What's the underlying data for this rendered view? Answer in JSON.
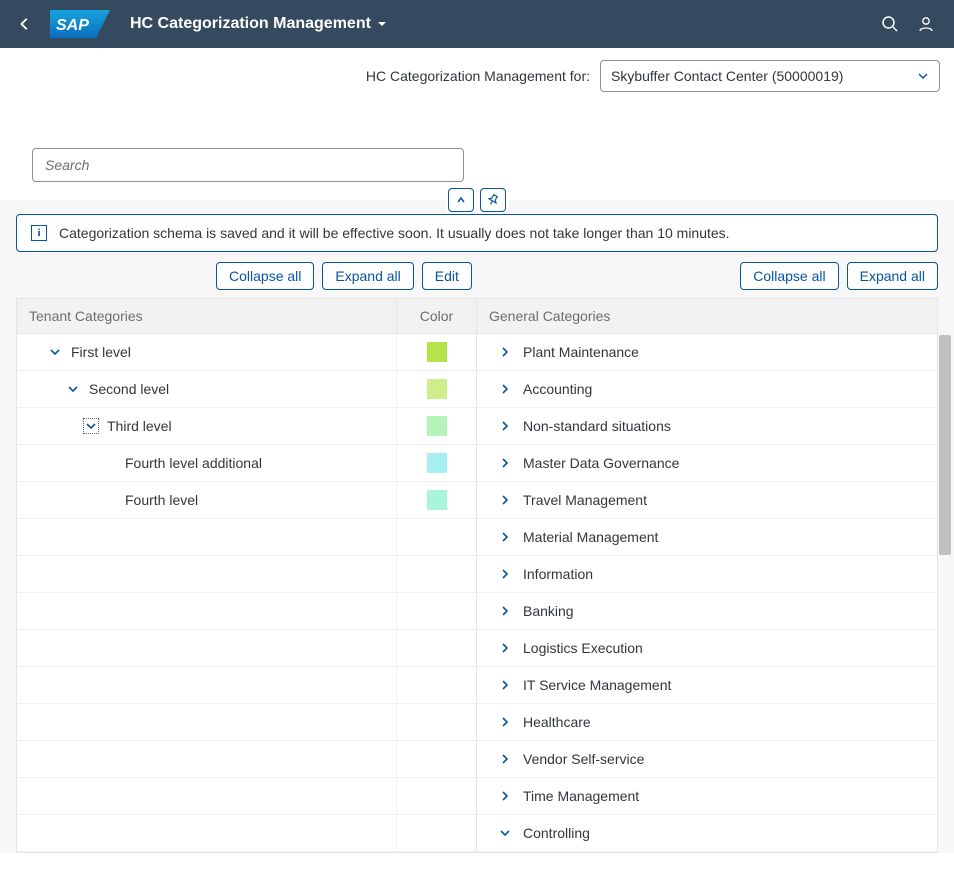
{
  "header": {
    "title": "HC Categorization Management"
  },
  "subbar": {
    "label": "HC Categorization Management for:",
    "select_value": "Skybuffer Contact Center (50000019)"
  },
  "search": {
    "placeholder": "Search"
  },
  "info": {
    "text": "Categorization schema is saved and it will be effective soon. It usually does not take longer than 10 minutes."
  },
  "buttons": {
    "collapse_all": "Collapse all",
    "expand_all": "Expand all",
    "edit": "Edit"
  },
  "left_table": {
    "header_name": "Tenant Categories",
    "header_color": "Color",
    "rows": [
      {
        "label": "First level",
        "indent": 0,
        "expander": "down",
        "color": "#b6e24a"
      },
      {
        "label": "Second level",
        "indent": 1,
        "expander": "down",
        "color": "#cdee8b"
      },
      {
        "label": "Third level",
        "indent": 2,
        "expander": "down-boxed",
        "color": "#b4f4b8"
      },
      {
        "label": "Fourth level additional",
        "indent": 3,
        "expander": "none",
        "color": "#a8f0f0"
      },
      {
        "label": "Fourth level",
        "indent": 3,
        "expander": "none",
        "color": "#a8f5d9"
      }
    ]
  },
  "right_table": {
    "header": "General Categories",
    "rows": [
      {
        "label": "Plant Maintenance",
        "expander": "right"
      },
      {
        "label": "Accounting",
        "expander": "right"
      },
      {
        "label": "Non-standard situations",
        "expander": "right"
      },
      {
        "label": "Master Data Governance",
        "expander": "right"
      },
      {
        "label": "Travel Management",
        "expander": "right"
      },
      {
        "label": "Material Management",
        "expander": "right"
      },
      {
        "label": "Information",
        "expander": "right"
      },
      {
        "label": "Banking",
        "expander": "right"
      },
      {
        "label": "Logistics Execution",
        "expander": "right"
      },
      {
        "label": "IT Service Management",
        "expander": "right"
      },
      {
        "label": "Healthcare",
        "expander": "right"
      },
      {
        "label": "Vendor Self-service",
        "expander": "right"
      },
      {
        "label": "Time Management",
        "expander": "right"
      },
      {
        "label": "Controlling",
        "expander": "down"
      }
    ]
  }
}
